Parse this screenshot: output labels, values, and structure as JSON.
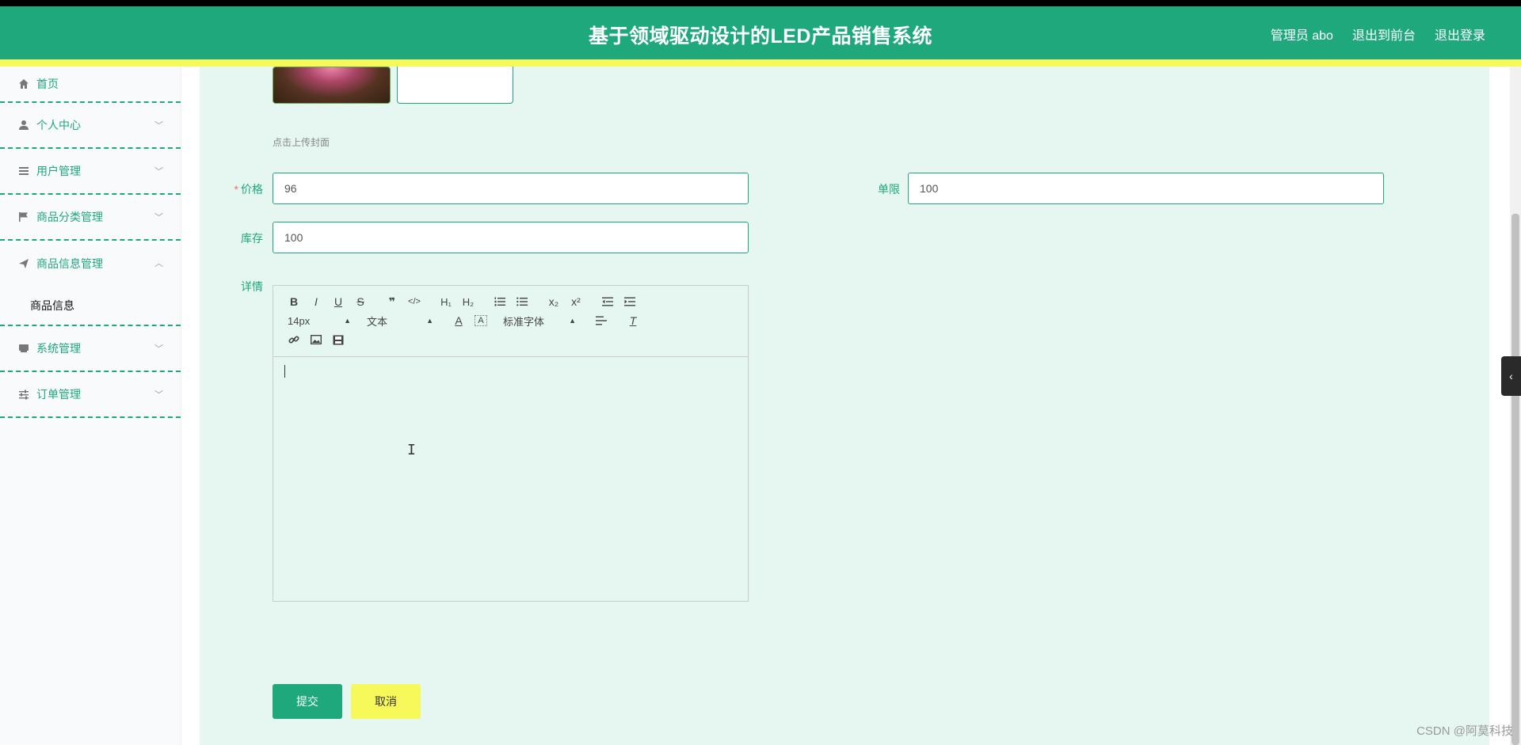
{
  "header": {
    "title": "基于领域驱动设计的LED产品销售系统",
    "user": "管理员 abo",
    "to_front": "退出到前台",
    "logout": "退出登录"
  },
  "sidebar": {
    "items": [
      {
        "label": "首页",
        "icon": "home-icon"
      },
      {
        "label": "个人中心",
        "icon": "user-icon"
      },
      {
        "label": "用户管理",
        "icon": "list-icon"
      },
      {
        "label": "商品分类管理",
        "icon": "flag-icon"
      },
      {
        "label": "商品信息管理",
        "icon": "send-icon"
      },
      {
        "label": "系统管理",
        "icon": "box-icon"
      },
      {
        "label": "订单管理",
        "icon": "sliders-icon"
      }
    ],
    "submenu": {
      "label": "商品信息"
    }
  },
  "form": {
    "upload_hint": "点击上传封面",
    "price": {
      "label": "价格",
      "value": "96"
    },
    "limit": {
      "label": "单限",
      "value": "100"
    },
    "stock": {
      "label": "库存",
      "value": "100"
    },
    "detail": {
      "label": "详情"
    }
  },
  "editor": {
    "font_size": "14px",
    "block_format": "文本",
    "font_family": "标准字体"
  },
  "buttons": {
    "submit": "提交",
    "cancel": "取消"
  },
  "watermark": "CSDN @阿莫科技",
  "colors": {
    "primary": "#1ea87c",
    "accent_yellow": "#f7f85a",
    "content_bg": "#e6f6f1"
  }
}
